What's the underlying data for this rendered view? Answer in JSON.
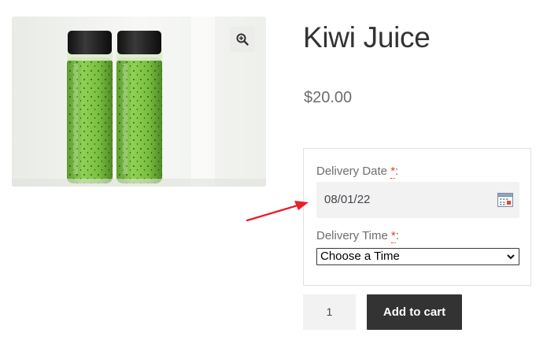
{
  "product": {
    "title": "Kiwi Juice",
    "price": "$20.00",
    "image_alt_icon": "zoom-in-icon"
  },
  "delivery": {
    "date_label": "Delivery Date ",
    "date_required_mark": "*",
    "date_label_suffix": ":",
    "date_value": "08/01/22",
    "time_label": "Delivery Time ",
    "time_required_mark": "*",
    "time_label_suffix": ":",
    "time_selected": "Choose a Time"
  },
  "cart": {
    "quantity": "1",
    "add_label": "Add to cart"
  },
  "colors": {
    "accent_arrow": "#e8202a",
    "button_bg": "#333333",
    "required": "#e2401c",
    "juice_green": "#7cc242"
  }
}
